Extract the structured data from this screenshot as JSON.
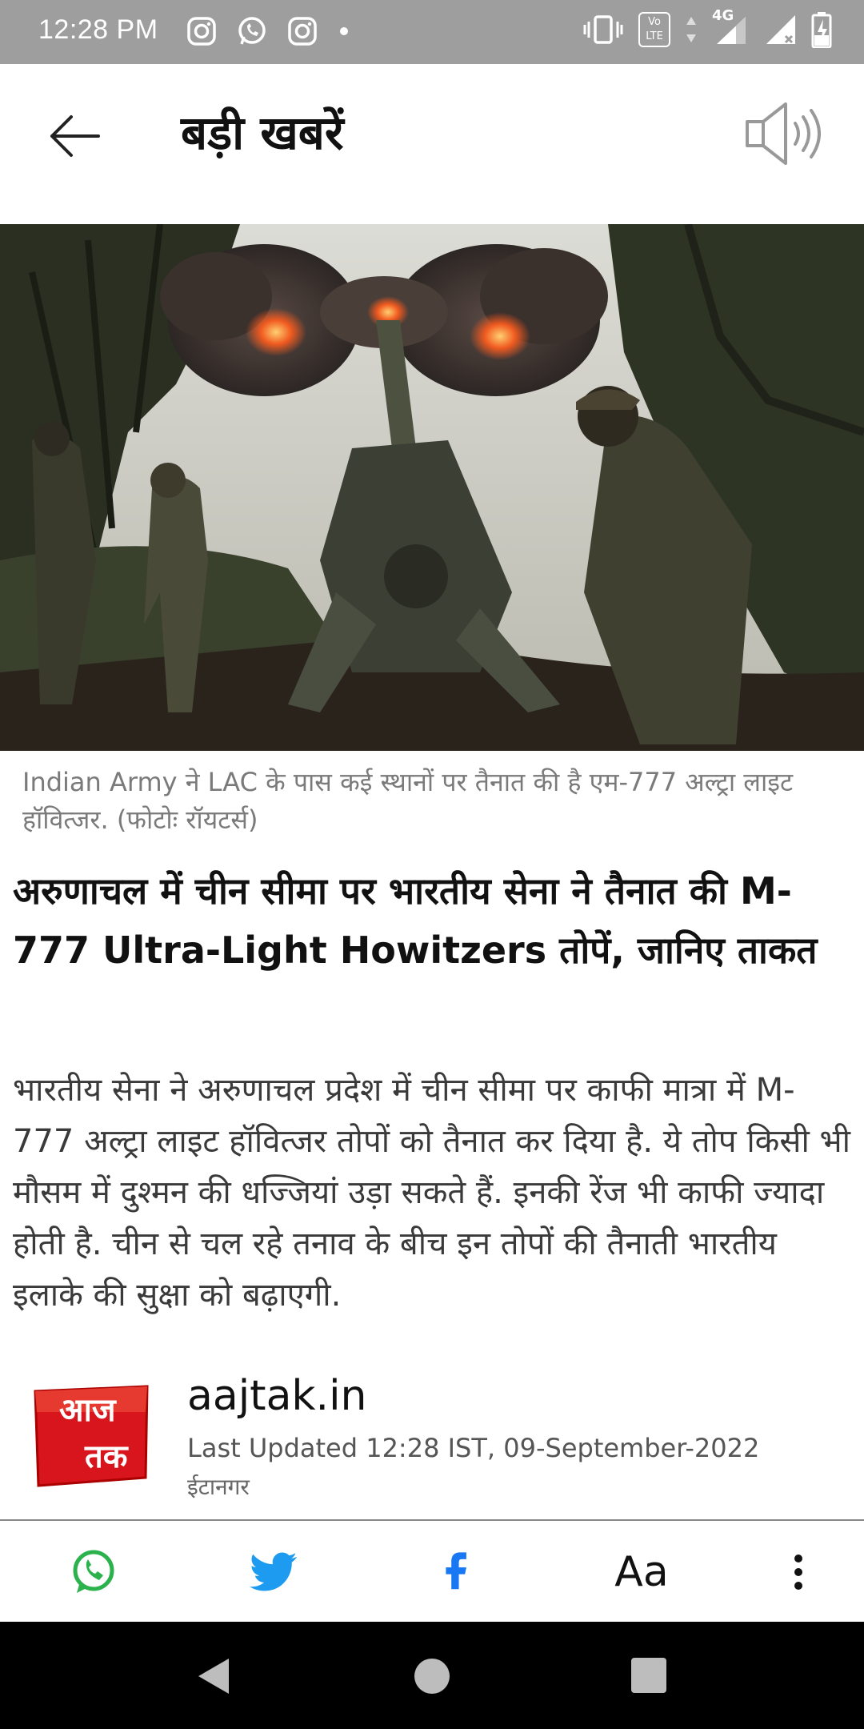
{
  "status": {
    "time": "12:28 PM",
    "network": "4G",
    "volte": "Vo LTE"
  },
  "header": {
    "title": "बड़ी खबरें"
  },
  "article": {
    "caption": "Indian Army ने LAC के पास कई स्थानों पर तैनात की है एम-777 अल्ट्रा लाइट हॉवित्जर. (फोटोः रॉयटर्स)",
    "headline": "अरुणाचल में चीन सीमा पर भारतीय सेना ने तैनात की M-777 Ultra-Light Howitzers तोपें, जानिए ताकत",
    "summary": "भारतीय सेना ने अरुणाचल प्रदेश में चीन सीमा पर काफी मात्रा में M-777 अल्ट्रा लाइट हॉवित्जर तोपों को तैनात कर दिया है. ये तोप किसी भी मौसम में दुश्मन की धज्जियां उड़ा सकते हैं. इनकी रेंज भी काफी ज्यादा होती है. चीन से चल रहे तनाव के बीच इन तोपों की तैनाती भारतीय इलाके की सुक्षा को बढ़ाएगी."
  },
  "source": {
    "name": "aajtak.in",
    "updated": "Last Updated 12:28 IST, 09-September-2022",
    "location": "ईटानगर",
    "logo_line1": "आज",
    "logo_line2": "तक"
  },
  "actions": {
    "font_label": "Aa"
  },
  "colors": {
    "whatsapp": "#2bb24c",
    "twitter": "#1d9bf0",
    "facebook": "#1877f2",
    "logo_red": "#d8141c"
  }
}
